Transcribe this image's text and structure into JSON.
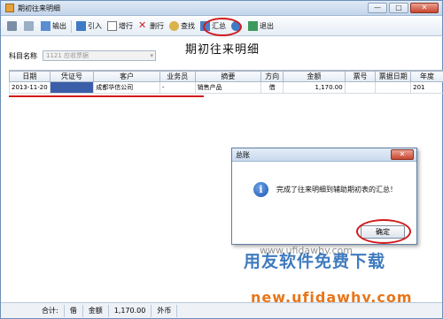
{
  "window": {
    "title": "期初往来明细",
    "min": "—",
    "max": "□",
    "close": "✕"
  },
  "toolbar": [
    {
      "name": "print-button",
      "label": ""
    },
    {
      "name": "preview-button",
      "label": ""
    },
    {
      "name": "export-button",
      "label": "输出"
    },
    {
      "name": "import-button",
      "label": "引入"
    },
    {
      "name": "add-row-button",
      "label": "增行"
    },
    {
      "name": "delete-row-button",
      "label": "删行"
    },
    {
      "name": "find-button",
      "label": "查找"
    },
    {
      "name": "summarize-button",
      "label": "汇总"
    },
    {
      "name": "help-button",
      "label": ""
    },
    {
      "name": "exit-button",
      "label": "退出"
    }
  ],
  "page_title": "期初往来明细",
  "subject": {
    "label": "科目名称",
    "value": "1121 应收票据"
  },
  "table": {
    "headers": [
      "日期",
      "凭证号",
      "客户",
      "业务员",
      "摘要",
      "方向",
      "金额",
      "票号",
      "票据日期",
      "年度"
    ],
    "rows": [
      [
        "2013-11-20",
        "",
        "成都华信公司",
        "-",
        "销售产品",
        "借",
        "1,170.00",
        "",
        "",
        "201"
      ]
    ]
  },
  "status": {
    "label": "合计:",
    "direction": "借",
    "amount_label": "金额",
    "amount": "1,170.00",
    "currency": "外币"
  },
  "dialog": {
    "title": "总账",
    "message": "完成了往来明细到辅助期初表的汇总！",
    "ok": "确定",
    "close": "✕"
  },
  "watermark": {
    "cn": "用友软件免费下载",
    "url": "new.ufidawhy.com",
    "faint": "www.ufidawhy.com"
  }
}
